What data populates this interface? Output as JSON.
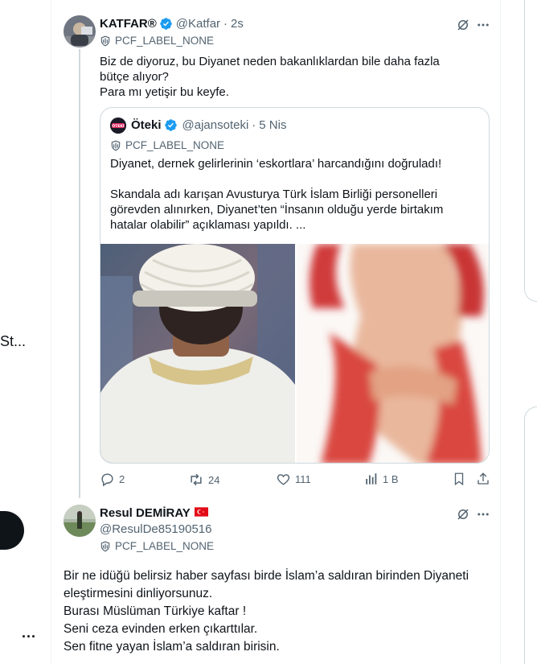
{
  "left_sidebar": {
    "truncated_text": "St...",
    "more_dots": "..."
  },
  "tweet1": {
    "name": "KATFAR®",
    "handle": "@Katfar",
    "time": "2s",
    "label": "PCF_LABEL_NONE",
    "text": "Biz de diyoruz, bu Diyanet neden bakanlıklardan bile daha fazla bütçe alıyor?\nPara mı yetişir bu keyfe.",
    "icons": {
      "grok": "slash-circle-icon",
      "more": "more-dots-icon",
      "verified": "verified-badge-icon",
      "label": "shield-label-icon"
    },
    "accent_color": "#1d9bf0"
  },
  "quote": {
    "name": "Öteki",
    "handle": "@ajansoteki",
    "time": "5 Nis",
    "label": "PCF_LABEL_NONE",
    "avatar_text": "ÖTEKİ",
    "line1": "Diyanet, dernek gelirlerinin ‘eskortlara’ harcandığını doğruladı!",
    "line2": "Skandala adı karışan Avusturya Türk İslam Birliği personelleri görevden alınırken, Diyanet’ten “İnsanın olduğu yerde birtakım hatalar olabilir” açıklaması yapıldı. ...",
    "images": [
      "man-in-turban-image",
      "woman-red-dress-image"
    ]
  },
  "actions": {
    "replies": "2",
    "reposts": "24",
    "likes": "111",
    "views": "1 B",
    "icons": [
      "reply-icon",
      "repost-icon",
      "like-icon",
      "views-icon",
      "bookmark-icon",
      "share-icon"
    ]
  },
  "tweet2": {
    "name": "Resul DEMİRAY",
    "flag": "turkey-flag-icon",
    "handle": "@ResulDe85190516",
    "label": "PCF_LABEL_NONE",
    "text": "Bir ne idüğü belirsiz haber sayfası birde İslam’a saldıran birinden Diyaneti eleştirmesini dinliyorsunuz.\nBurası Müslüman Türkiye kaftar !\nSeni ceza evinden erken çıkarttılar.\nSen fitne yayan İslam’a saldıran  birisin."
  }
}
